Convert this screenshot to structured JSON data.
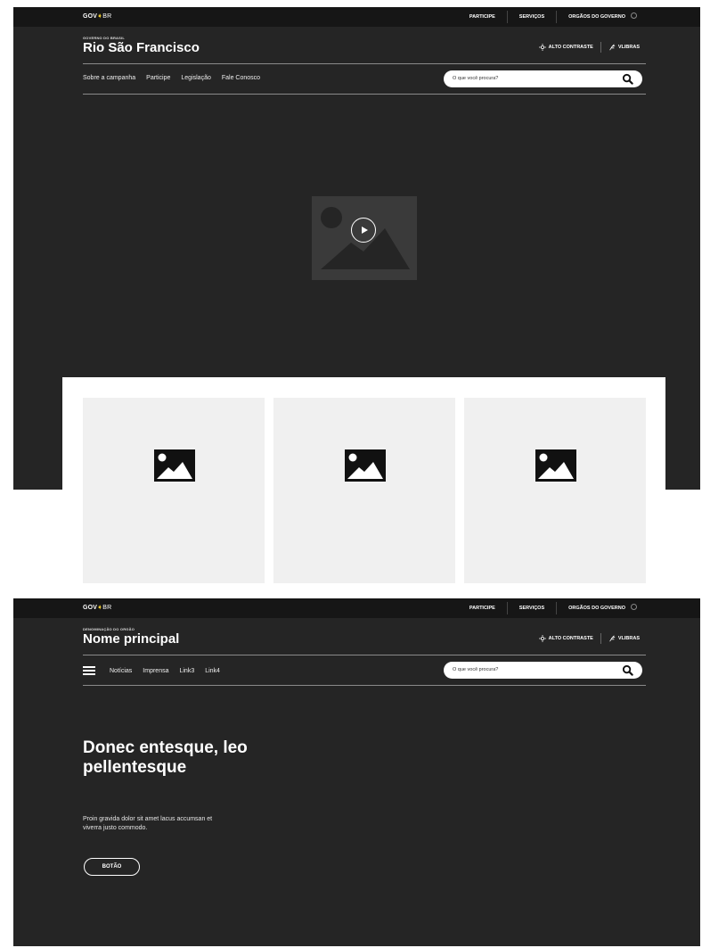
{
  "frame1": {
    "topbar": {
      "logo_gov": "GOV",
      "logo_br": "BR",
      "links": [
        "PARTICIPE",
        "SERVIÇOS",
        "ORGÃOS DO GOVERNO"
      ]
    },
    "header": {
      "subtitle": "GOVERNO DO BRASIL",
      "title": "Rio São Francisco",
      "high_contrast": "ALTO CONTRASTE",
      "vlibras": "VLIBRAS"
    },
    "nav": {
      "items": [
        "Sobre a campanha",
        "Participe",
        "Legislação",
        "Fale Conosco"
      ]
    },
    "search": {
      "placeholder": "O que você procura?"
    },
    "icons": [
      "play-icon",
      "image-placeholder-icon"
    ]
  },
  "frame2": {
    "topbar": {
      "logo_gov": "GOV",
      "logo_br": "BR",
      "links": [
        "PARTICIPE",
        "SERVIÇOS",
        "ORGÃOS DO GOVERNO"
      ]
    },
    "header": {
      "subtitle": "DENOMINAÇÃO DO ORGÃO",
      "title": "Nome principal",
      "high_contrast": "ALTO CONTRASTE",
      "vlibras": "VLIBRAS"
    },
    "nav": {
      "items": [
        "Notícias",
        "Imprensa",
        "Link3",
        "Link4"
      ]
    },
    "search": {
      "placeholder": "O que você procura?"
    },
    "hero": {
      "title": "Donec entesque, leo pellentesque",
      "text": "Proin gravida dolor sit amet lacus accumsan et viverra justo commodo.",
      "button": "BOTÃO"
    }
  },
  "colors": {
    "background_dark": "#252525",
    "topbar": "#161616",
    "card_bg": "#f0f0f0",
    "gov_accent": "#e8c52a"
  }
}
